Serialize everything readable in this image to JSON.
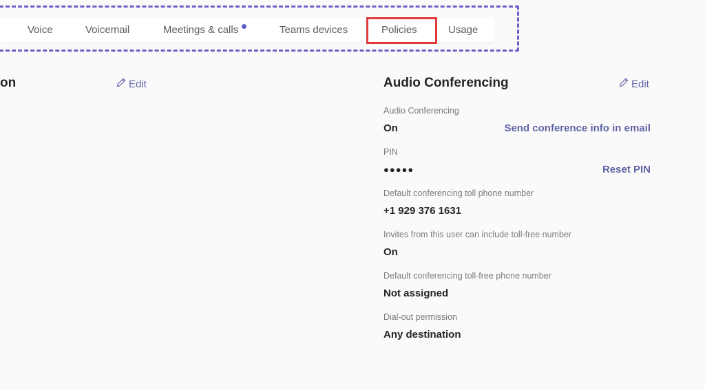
{
  "tabs": {
    "items": [
      {
        "label": "Voice",
        "has_indicator": false
      },
      {
        "label": "Voicemail",
        "has_indicator": false
      },
      {
        "label": "Meetings & calls",
        "has_indicator": true
      },
      {
        "label": "Teams devices",
        "has_indicator": false
      },
      {
        "label": "Policies",
        "has_indicator": false,
        "highlighted": true
      },
      {
        "label": "Usage",
        "has_indicator": false
      }
    ],
    "highlight_color": "#e03a3a",
    "frame_color": "#6b5fc7",
    "indicator_color": "#5b5fc7"
  },
  "left_section": {
    "title_fragment": "on",
    "edit_label": "Edit"
  },
  "audio_conferencing": {
    "title": "Audio Conferencing",
    "edit_label": "Edit",
    "fields": [
      {
        "label": "Audio Conferencing",
        "value": "On",
        "action": "Send conference info in email"
      },
      {
        "label": "PIN",
        "value": "●●●●●",
        "action": "Reset PIN"
      },
      {
        "label": "Default conferencing toll phone number",
        "value": "+1 929 376 1631"
      },
      {
        "label": "Invites from this user can include toll-free number",
        "value": "On"
      },
      {
        "label": "Default conferencing toll-free phone number",
        "value": "Not assigned"
      },
      {
        "label": "Dial-out permission",
        "value": "Any destination"
      }
    ]
  },
  "colors": {
    "accent": "#6264a7",
    "background": "#fafafa",
    "text": "#242424",
    "label": "#7a7a7a"
  }
}
